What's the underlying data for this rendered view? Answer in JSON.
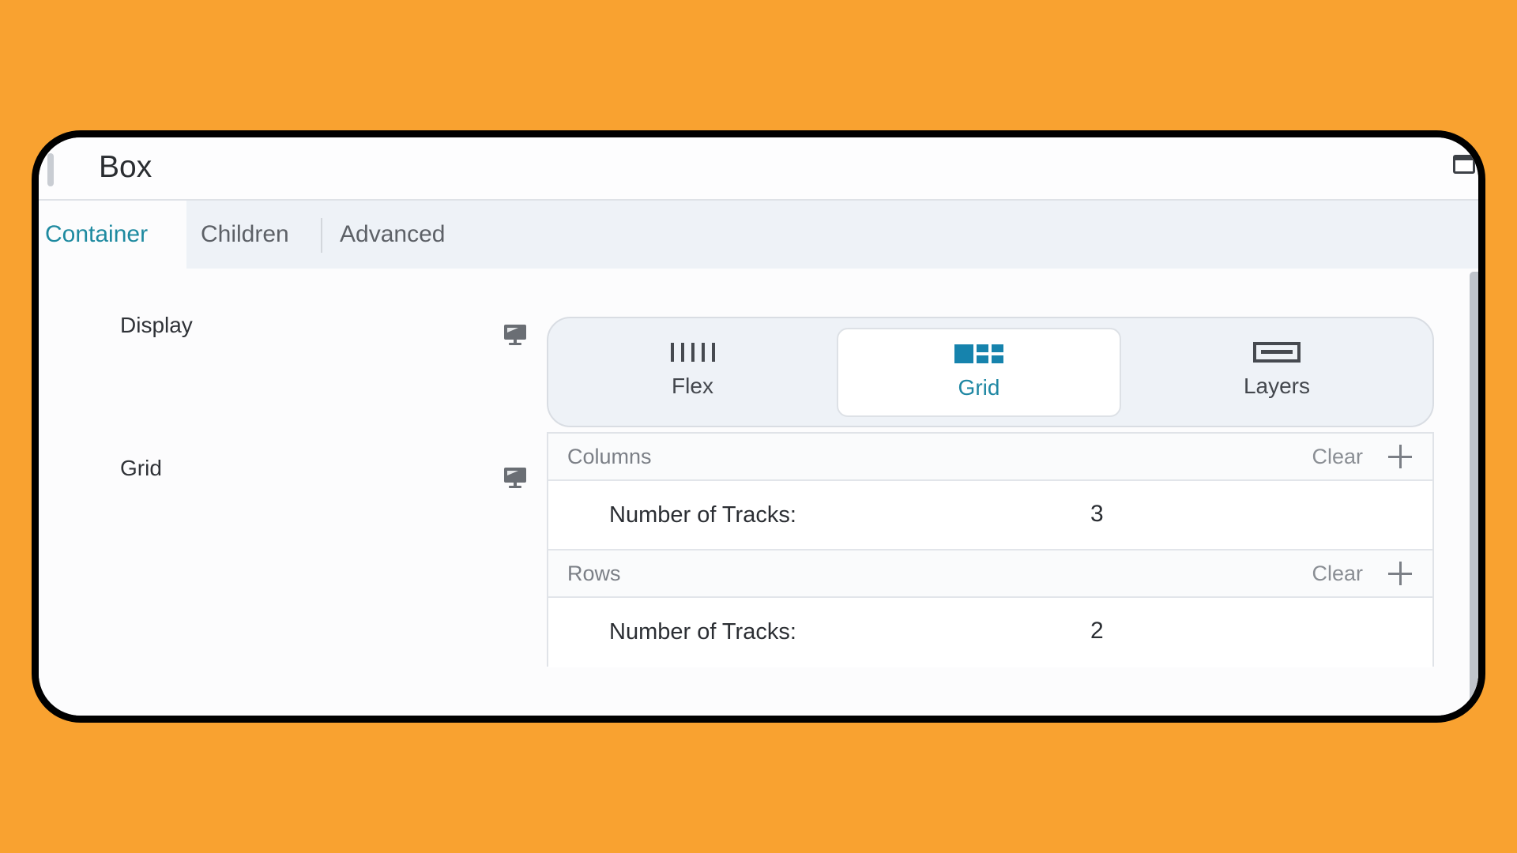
{
  "window": {
    "title": "Box",
    "restore_icon": "window-maximize-icon"
  },
  "tabs": [
    {
      "label": "Container",
      "active": true
    },
    {
      "label": "Children",
      "active": false
    },
    {
      "label": "Advanced",
      "active": false
    }
  ],
  "display": {
    "label": "Display",
    "responsive_icon": "desktop-monitor-icon",
    "options": [
      {
        "label": "Flex",
        "icon": "flex-columns-icon",
        "active": false
      },
      {
        "label": "Grid",
        "icon": "grid-layout-icon",
        "active": true
      },
      {
        "label": "Layers",
        "icon": "layers-stack-icon",
        "active": false
      }
    ]
  },
  "grid": {
    "label": "Grid",
    "responsive_icon": "desktop-monitor-icon",
    "sections": [
      {
        "title": "Columns",
        "clear_label": "Clear",
        "add_icon": "plus-icon",
        "row_label": "Number of Tracks:",
        "value": "3"
      },
      {
        "title": "Rows",
        "clear_label": "Clear",
        "add_icon": "plus-icon",
        "row_label": "Number of Tracks:",
        "value": "2"
      }
    ]
  },
  "colors": {
    "background": "#f9a230",
    "accent": "#1f87a3",
    "frame_border": "#000000"
  }
}
